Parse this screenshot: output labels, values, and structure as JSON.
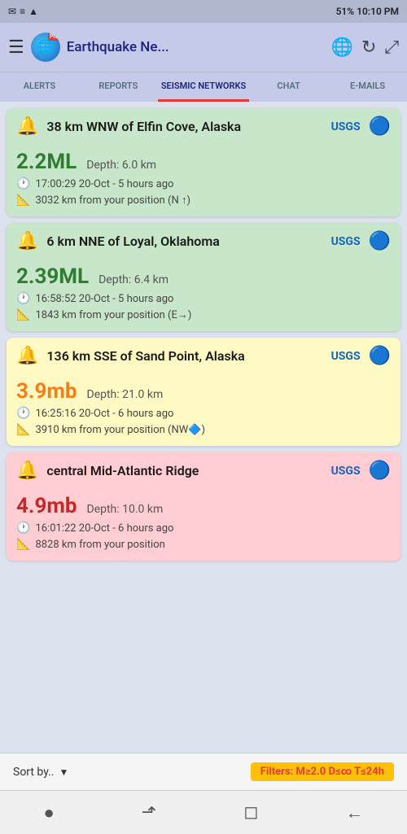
{
  "statusBar": {
    "leftIcons": [
      "✉",
      "☰",
      "📶"
    ],
    "rightText": "51%  10:10 PM"
  },
  "header": {
    "menuIcon": "☰",
    "logoEmoji": "🌐",
    "proLabel": "Pro",
    "title": "Earthquake Ne...",
    "globeIcon": "🌐",
    "refreshIcon": "↻",
    "expandIcon": "⤢"
  },
  "tabs": [
    {
      "id": "alerts",
      "label": "ALERTS",
      "active": false
    },
    {
      "id": "reports",
      "label": "REPORTS",
      "active": false
    },
    {
      "id": "seismic",
      "label": "SEISMIC NETWORKS",
      "active": true
    },
    {
      "id": "chat",
      "label": "CHAT",
      "active": false
    },
    {
      "id": "emails",
      "label": "E-MAILS",
      "active": false
    }
  ],
  "cards": [
    {
      "id": "card1",
      "colorClass": "card-green",
      "icon": "🔔",
      "title": "38 km WNW of Elfin Cove, Alaska",
      "source": "USGS",
      "magnitude": "2.2ML",
      "depth": "Depth: 6.0 km",
      "time": "17:00:29 20-Oct - 5 hours ago",
      "distance": "3032 km from your position (N ↑)"
    },
    {
      "id": "card2",
      "colorClass": "card-green",
      "icon": "🔔",
      "title": "6 km NNE of Loyal, Oklahoma",
      "source": "USGS",
      "magnitude": "2.39ML",
      "depth": "Depth: 6.4 km",
      "time": "16:58:52 20-Oct - 5 hours ago",
      "distance": "1843 km from your position (E→)"
    },
    {
      "id": "card3",
      "colorClass": "card-yellow",
      "icon": "🔔",
      "title": "136 km SSE of Sand Point, Alaska",
      "source": "USGS",
      "magnitude": "3.9mb",
      "depth": "Depth: 21.0 km",
      "time": "16:25:16 20-Oct - 6 hours ago",
      "distance": "3910 km from your position (NW🔷)"
    },
    {
      "id": "card4",
      "colorClass": "card-red",
      "icon": "🔔",
      "title": "central Mid-Atlantic Ridge",
      "source": "USGS",
      "magnitude": "4.9mb",
      "depth": "Depth: 10.0 km",
      "time": "16:01:22 20-Oct - 6 hours ago",
      "distance": "8828 km from your position"
    }
  ],
  "bottomBar": {
    "sortLabel": "Sort by..",
    "filterText": "Filters: M≥",
    "filterMag": "2.0",
    "filterRest": " D≤∞ T≤24h"
  },
  "navBar": {
    "icons": [
      "●",
      "⬏",
      "◻",
      "←"
    ]
  }
}
